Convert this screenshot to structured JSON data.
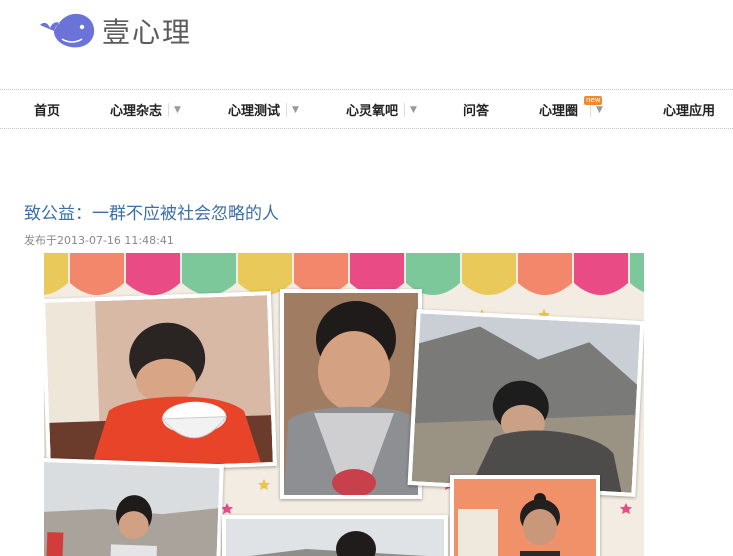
{
  "brand": {
    "name": "壹心理",
    "logo_icon": "whale-logo-icon",
    "color": "#6b73d9"
  },
  "nav": {
    "items": [
      {
        "label": "首页",
        "has_dropdown": false
      },
      {
        "label": "心理杂志",
        "has_dropdown": true
      },
      {
        "label": "心理测试",
        "has_dropdown": true
      },
      {
        "label": "心灵氧吧",
        "has_dropdown": true
      },
      {
        "label": "问答",
        "has_dropdown": false
      },
      {
        "label": "心理圈",
        "has_dropdown": true,
        "badge": "new"
      },
      {
        "label": "心理应用",
        "has_dropdown": false
      }
    ],
    "dropdown_icon": "chevron-down-icon"
  },
  "article": {
    "title": "致公益：一群不应被社会忽略的人",
    "meta": "发布于2013-07-16 11:48:41",
    "image_description_icon": "photo-collage-image"
  },
  "colors": {
    "title": "#3b6fa8",
    "awning": [
      "#e8c95a",
      "#f2876b",
      "#e94c84",
      "#7cc89a",
      "#e8c95a",
      "#f2876b",
      "#e94c84",
      "#7cc89a",
      "#e8c95a",
      "#f2876b",
      "#e94c84",
      "#7cc89a"
    ]
  }
}
